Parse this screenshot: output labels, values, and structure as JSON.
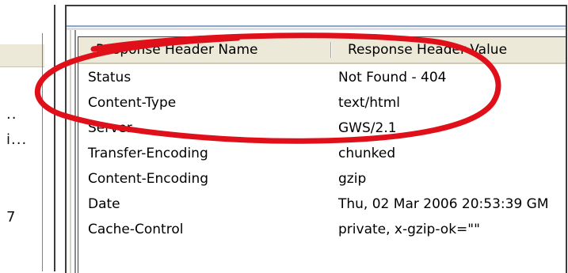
{
  "left_pane": {
    "fragments": [
      "..",
      "i...",
      "7"
    ]
  },
  "listview": {
    "columns": [
      {
        "label": "Response Header Name"
      },
      {
        "label": "Response Header Value"
      }
    ],
    "rows": [
      {
        "name": "Status",
        "value": "Not Found - 404"
      },
      {
        "name": "Content-Type",
        "value": "text/html"
      },
      {
        "name": "Server",
        "value": "GWS/2.1"
      },
      {
        "name": "Transfer-Encoding",
        "value": "chunked"
      },
      {
        "name": "Content-Encoding",
        "value": "gzip"
      },
      {
        "name": "Date",
        "value": "Thu, 02 Mar 2006 20:53:39 GM"
      },
      {
        "name": "Cache-Control",
        "value": "private, x-gzip-ok=\"\""
      }
    ]
  },
  "annotation": {
    "type": "hand-drawn ellipse",
    "color": "#e0101a"
  }
}
